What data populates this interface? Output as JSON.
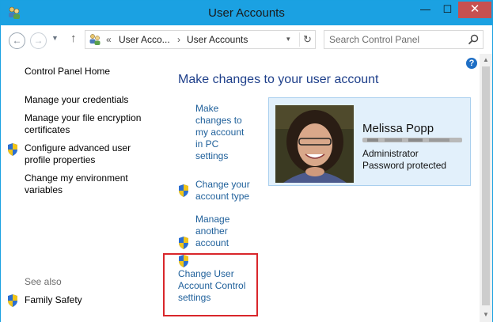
{
  "window": {
    "title": "User Accounts",
    "controls": {
      "minimize": "—",
      "maximize": "☐",
      "close": "✕"
    }
  },
  "nav": {
    "back_glyph": "←",
    "forward_glyph": "→",
    "dropdown_glyph": "▼",
    "up_glyph": "↑",
    "address": {
      "sep1": "«",
      "crumb1": "User Acco...",
      "sep2": "›",
      "crumb2": "User Accounts",
      "dropdown_glyph": "▾",
      "refresh_glyph": "↻"
    },
    "search": {
      "placeholder": "Search Control Panel"
    }
  },
  "sidebar": {
    "home": "Control Panel Home",
    "links": [
      {
        "label": "Manage your credentials",
        "shield": false
      },
      {
        "label": "Manage your file encryption certificates",
        "shield": false
      },
      {
        "label": "Configure advanced user profile properties",
        "shield": true
      },
      {
        "label": "Change my environment variables",
        "shield": false
      }
    ],
    "see_also": "See also",
    "see_also_links": [
      {
        "label": "Family Safety",
        "shield": true
      }
    ]
  },
  "main": {
    "heading": "Make changes to your user account",
    "tasks": [
      {
        "label": "Make changes to my account in PC settings",
        "shield": false
      },
      {
        "label": "Change your account type",
        "shield": true
      },
      {
        "label": "Manage another account",
        "shield": true
      },
      {
        "label": "Change User Account Control settings",
        "shield": true
      }
    ],
    "user": {
      "name": "Melissa Popp",
      "role": "Administrator",
      "password_status": "Password protected"
    },
    "help_glyph": "?"
  },
  "colors": {
    "titlebar": "#1ba1e2",
    "link": "#1e5f9a",
    "heading": "#1e3f8a",
    "highlight": "#d9262b",
    "user_card": "#e2f0fb"
  },
  "icons": [
    "user-accounts-icon",
    "uac-shield-icon",
    "search-icon",
    "refresh-icon",
    "help-icon"
  ]
}
